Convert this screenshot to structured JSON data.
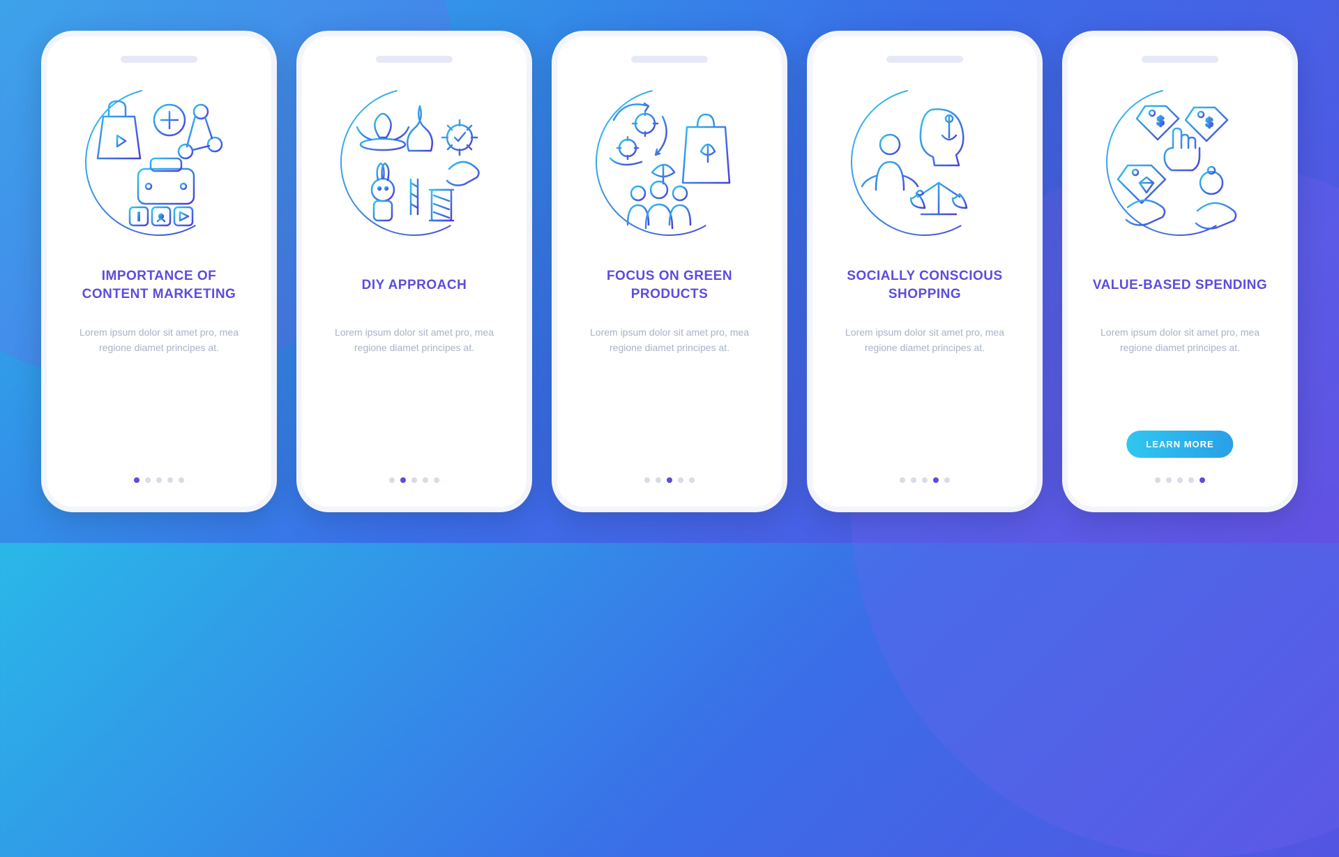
{
  "screens": [
    {
      "title": "IMPORTANCE OF CONTENT MARKETING",
      "desc": "Lorem ipsum dolor sit amet pro, mea regione diamet principes at.",
      "icon": "content-marketing-icon"
    },
    {
      "title": "DIY APPROACH",
      "desc": "Lorem ipsum dolor sit amet pro, mea regione diamet principes at.",
      "icon": "diy-icon"
    },
    {
      "title": "FOCUS ON GREEN PRODUCTS",
      "desc": "Lorem ipsum dolor sit amet pro, mea regione diamet principes at.",
      "icon": "green-products-icon"
    },
    {
      "title": "SOCIALLY CONSCIOUS SHOPPING",
      "desc": "Lorem ipsum dolor sit amet pro, mea regione diamet principes at.",
      "icon": "social-shopping-icon"
    },
    {
      "title": "VALUE-BASED SPENDING",
      "desc": "Lorem ipsum dolor sit amet pro, mea regione diamet principes at.",
      "icon": "value-spending-icon"
    }
  ],
  "button_label": "LEARN MORE",
  "colors": {
    "accent": "#5b4ce0",
    "gradient_start": "#2ab8e8",
    "gradient_end": "#5b4ce0",
    "muted": "#a9b2c4"
  },
  "total_dots": 5
}
